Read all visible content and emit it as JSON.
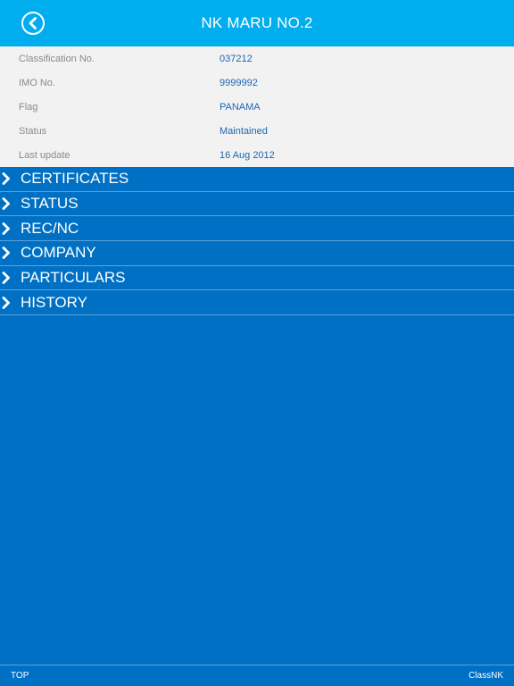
{
  "header": {
    "title": "NK MARU NO.2",
    "back_icon": "back-arrow-circle-icon"
  },
  "info": [
    {
      "label": "Classification No.",
      "value": "037212"
    },
    {
      "label": "IMO No.",
      "value": "9999992"
    },
    {
      "label": "Flag",
      "value": "PANAMA"
    },
    {
      "label": "Status",
      "value": "Maintained"
    },
    {
      "label": "Last update",
      "value": "16 Aug 2012"
    }
  ],
  "sections": [
    {
      "label": "CERTIFICATES"
    },
    {
      "label": "STATUS"
    },
    {
      "label": "REC/NC"
    },
    {
      "label": "COMPANY"
    },
    {
      "label": "PARTICULARS"
    },
    {
      "label": "HISTORY"
    }
  ],
  "footer": {
    "left": "TOP",
    "right": "ClassNK"
  },
  "colors": {
    "header": "#00aeef",
    "background": "#0070c4",
    "info_background": "#f2f2f2",
    "value_text": "#1a66b5",
    "label_text": "#8a8a8a"
  }
}
